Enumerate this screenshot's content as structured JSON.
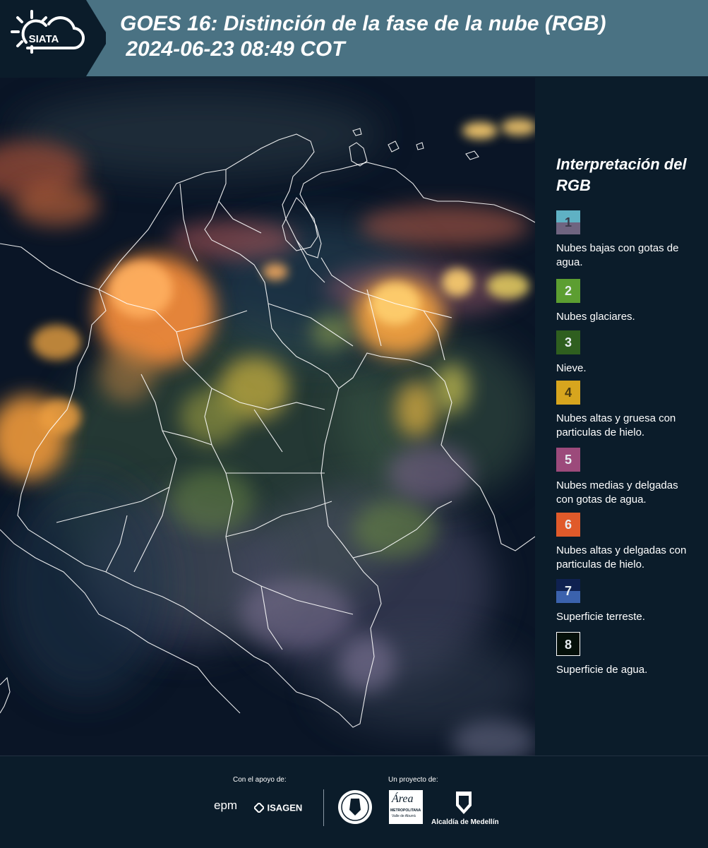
{
  "header": {
    "logo_text": "SIATA",
    "title": "GOES 16: Distinción de la fase de la nube (RGB)\n 2024-06-23 08:49 COT"
  },
  "legend": {
    "title": "Interpretación del RGB",
    "items": [
      {
        "number": "1",
        "label": "Nubes bajas con gotas de agua.",
        "color_top": "#5fb1c4",
        "color_bottom": "#6f6480"
      },
      {
        "number": "2",
        "label": "Nubes glaciares.",
        "color": "#5c9e31"
      },
      {
        "number": "3",
        "label": "Nieve.",
        "color": "#2f5f1f"
      },
      {
        "number": "4",
        "label": "Nubes altas y gruesa con particulas de hielo.",
        "color": "#d7a51e"
      },
      {
        "number": "5",
        "label": "Nubes medias y delgadas con gotas de agua.",
        "color": "#9c4a7b"
      },
      {
        "number": "6",
        "label": "Nubes altas y delgadas con particulas de hielo.",
        "color": "#e05a2a"
      },
      {
        "number": "7",
        "label": "Superficie terreste.",
        "color_top": "#0f2150",
        "color_bottom": "#3b62ad"
      },
      {
        "number": "8",
        "label": "Superficie de agua.",
        "color": "#05100a"
      }
    ]
  },
  "footer": {
    "support_label": "Con el apoyo de:",
    "project_label": "Un proyecto de:",
    "epm_text": "epm",
    "isagen_text": "ISAGEN",
    "area_text": "Área",
    "area_sub": "METROPOLITANA",
    "area_sub2": "Valle de Aburrá",
    "alcaldia_text": "Alcaldía de Medellín"
  }
}
